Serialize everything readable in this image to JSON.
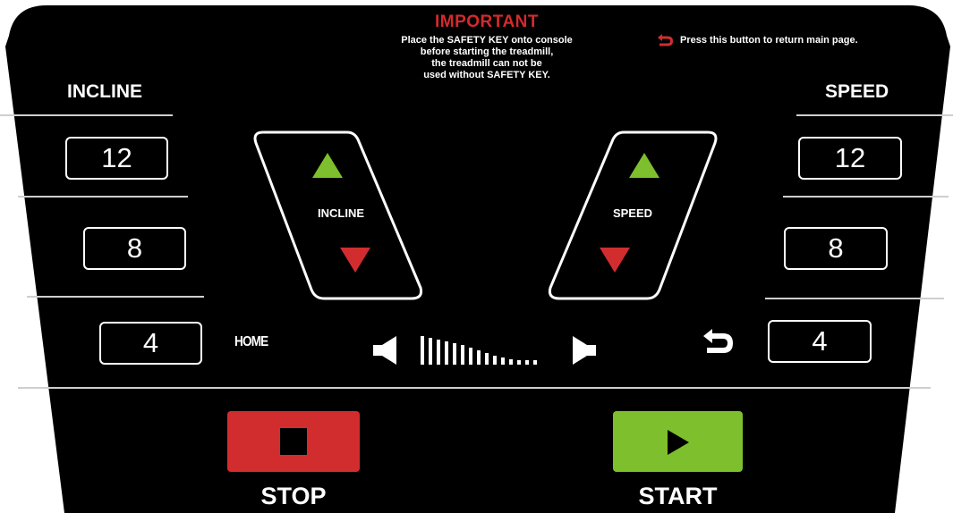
{
  "important": {
    "title": "IMPORTANT",
    "line1": "Place the SAFETY KEY onto console",
    "line2": "before starting the treadmill,",
    "line3": "the treadmill can not be",
    "line4": "used without SAFETY KEY."
  },
  "return_note": "Press this button to return main page.",
  "incline": {
    "title": "INCLINE",
    "presets": [
      "12",
      "8",
      "4"
    ],
    "pad_label": "INCLINE"
  },
  "speed": {
    "title": "SPEED",
    "presets": [
      "12",
      "8",
      "4"
    ],
    "pad_label": "SPEED"
  },
  "home_label": "HOME",
  "stop_label": "STOP",
  "start_label": "START",
  "colors": {
    "background": "#000000",
    "accent_red": "#d12d2f",
    "accent_green": "#7ebf2d",
    "text": "#ffffff",
    "divider": "#cfcfcf"
  },
  "icons": {
    "up": "triangle-up-icon",
    "down": "triangle-down-icon",
    "return": "return-arrow-icon",
    "volume_down": "volume-down-icon",
    "volume_up": "volume-up-icon",
    "stop": "stop-square-icon",
    "start": "play-triangle-icon"
  }
}
